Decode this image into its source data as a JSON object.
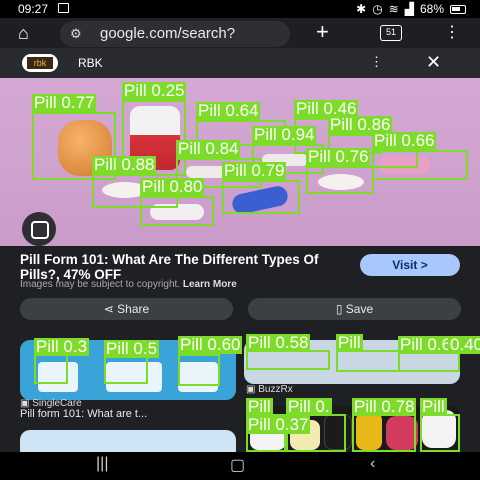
{
  "status": {
    "time": "09:27",
    "battery": "68%",
    "gallery_icon": "image-icon"
  },
  "browser": {
    "url": "google.com/search?",
    "tab_count": "51",
    "home_icon": "home-icon",
    "plus_icon": "plus-icon",
    "menu_icon": "more-vert-icon"
  },
  "sheet": {
    "logo_text": "rbk",
    "site_name": "RBK"
  },
  "result": {
    "headline": "Pill Form 101: What Are The Different Types Of Pills?, 47% OFF",
    "copyright": "Images may be subject to copyright.",
    "learn_more": "Learn More",
    "visit_label": "Visit >",
    "share_label": "Share",
    "save_label": "Save"
  },
  "cards": [
    {
      "source": "SingleCare",
      "title": "Pill form 101: What are t..."
    },
    {
      "source": "BuzzRx",
      "title": ""
    }
  ],
  "detections_top": [
    {
      "label": "Pill 0.77"
    },
    {
      "label": "Pill 0.25"
    },
    {
      "label": "Pill 0.64"
    },
    {
      "label": "Pill 0.46"
    },
    {
      "label": "Pill 0.94"
    },
    {
      "label": "Pill 0.86"
    },
    {
      "label": "Pill 0.84"
    },
    {
      "label": "Pill 0.66"
    },
    {
      "label": "Pill 0.88"
    },
    {
      "label": "Pill 0.76"
    },
    {
      "label": "Pill 0.79"
    },
    {
      "label": "Pill 0.80"
    }
  ],
  "detections_bottom": [
    {
      "label": "Pill 0.3"
    },
    {
      "label": "Pill 0.5"
    },
    {
      "label": "Pill 0.60"
    },
    {
      "label": "Pill 0.58"
    },
    {
      "label": "Pill"
    },
    {
      "label": "Pill 0.65"
    },
    {
      "label": "0.40"
    },
    {
      "label": "Pill"
    },
    {
      "label": "Pill 0."
    },
    {
      "label": "Pill 0.78"
    },
    {
      "label": "Pill"
    },
    {
      "label": "Pill 0.37"
    }
  ],
  "colors": {
    "detection": "#7ddc2a",
    "visit_button": "#a8c7fa"
  }
}
